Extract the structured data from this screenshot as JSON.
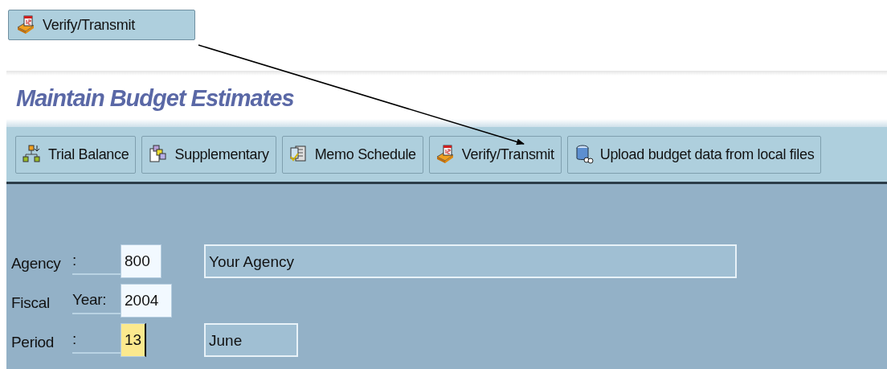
{
  "callout_button": {
    "label": "Verify/Transmit",
    "kind": "transmit"
  },
  "title": "Maintain Budget Estimates",
  "toolbar": [
    {
      "label": "Trial Balance",
      "kind": "hierarchy"
    },
    {
      "label": "Supplementary",
      "kind": "documents"
    },
    {
      "label": "Memo Schedule",
      "kind": "memo"
    },
    {
      "label": "Verify/Transmit",
      "kind": "transmit"
    },
    {
      "label": "Upload budget data from local files",
      "kind": "upload"
    }
  ],
  "fields": [
    {
      "label_parts": [
        "Agency",
        ":"
      ],
      "value": "800",
      "focused": false,
      "description": "Your Agency"
    },
    {
      "label_parts": [
        "Fiscal",
        "Year:"
      ],
      "value": "2004",
      "focused": false
    },
    {
      "label_parts": [
        "Period",
        ":"
      ],
      "value": "13",
      "focused": true,
      "description": "June"
    }
  ]
}
